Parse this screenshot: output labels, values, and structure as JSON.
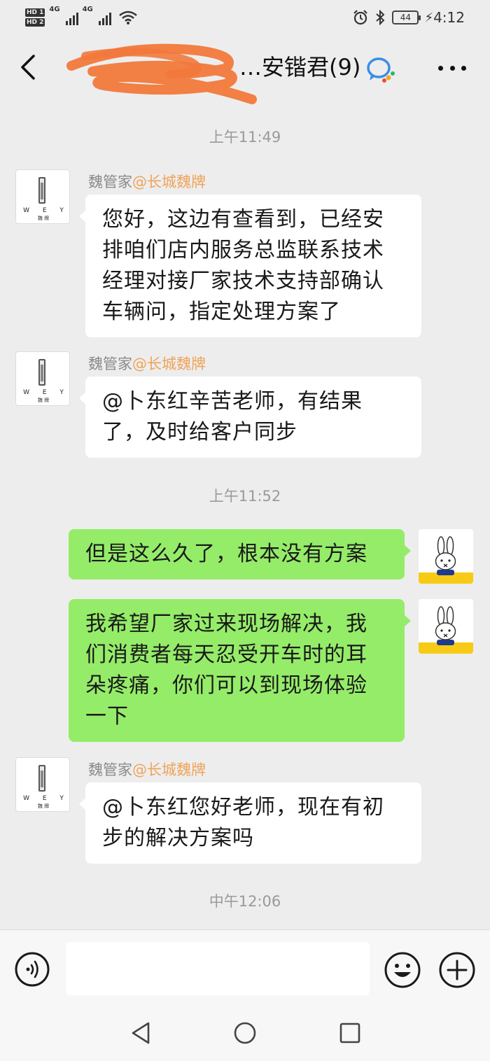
{
  "status_bar": {
    "hd1": "HD 1",
    "hd2": "HD 2",
    "net1": "4G",
    "net2": "4G",
    "battery": "44",
    "time": "4:12"
  },
  "header": {
    "title": "…安锴君(9)"
  },
  "messages": [
    {
      "type": "time",
      "text": "上午11:49"
    },
    {
      "type": "incoming",
      "sender": "魏管家",
      "sender_corp": "@长城魏牌",
      "text": "您好，这边有查看到，已经安排咱们店内服务总监联系技术经理对接厂家技术支持部确认车辆问，指定处理方案了"
    },
    {
      "type": "incoming",
      "sender": "魏管家",
      "sender_corp": "@长城魏牌",
      "text": "@卜东红辛苦老师，有结果了，及时给客户同步"
    },
    {
      "type": "time",
      "text": "上午11:52"
    },
    {
      "type": "outgoing",
      "text": "但是这么久了，根本没有方案"
    },
    {
      "type": "outgoing",
      "text": "我希望厂家过来现场解决，我们消费者每天忍受开车时的耳朵疼痛，你们可以到现场体验一下"
    },
    {
      "type": "incoming",
      "sender": "魏管家",
      "sender_corp": "@长城魏牌",
      "text": "@卜东红您好老师，现在有初步的解决方案吗"
    },
    {
      "type": "time",
      "text": "中午12:06"
    }
  ],
  "avatar": {
    "wey_logo": "W E Y",
    "wey_cn": "魏 牌"
  },
  "input": {
    "value": "",
    "placeholder": ""
  },
  "icons": {
    "back": "chevron-left-icon",
    "more": "more-dots-icon",
    "wework": "wework-icon",
    "voice": "voice-icon",
    "emoji": "emoji-icon",
    "plus": "plus-icon"
  },
  "colors": {
    "background": "#ededed",
    "outgoing_bubble": "#95ec69",
    "incoming_bubble": "#ffffff",
    "sender_corp": "#f0a35a",
    "timestamp": "#9a9a9a"
  }
}
